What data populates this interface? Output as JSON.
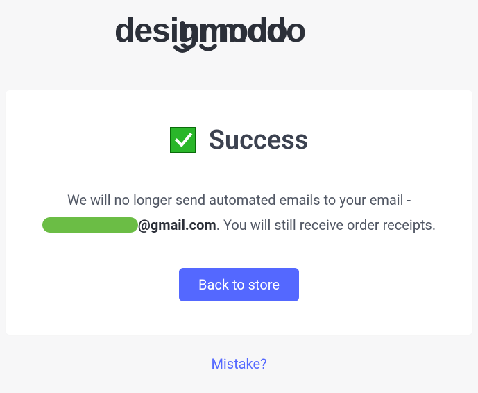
{
  "logo": {
    "text": "designmodo"
  },
  "card": {
    "heading": "Success",
    "message_prefix": "We will no longer send automated emails to your email - ",
    "email_domain": "@gmail.com",
    "message_suffix": ". You will still receive order receipts.",
    "button_label": "Back to store"
  },
  "footer": {
    "mistake_label": "Mistake?"
  }
}
